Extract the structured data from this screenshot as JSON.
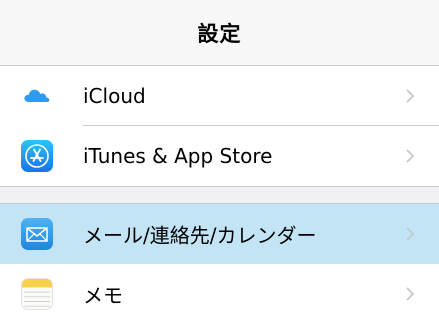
{
  "nav": {
    "title": "設定"
  },
  "settings": {
    "groups": [
      {
        "rows": [
          {
            "label": "iCloud",
            "icon": "icloud-icon",
            "selected": false
          },
          {
            "label": "iTunes & App Store",
            "icon": "app-store-icon",
            "selected": false
          }
        ]
      },
      {
        "rows": [
          {
            "label": "メール/連絡先/カレンダー",
            "icon": "mail-icon",
            "selected": true
          },
          {
            "label": "メモ",
            "icon": "notes-icon",
            "selected": false
          }
        ]
      }
    ]
  },
  "colors": {
    "selected_row": "#c2e4f4",
    "icloud_blue": "#2f9bf0",
    "app_store_blue": "#1d9bf0",
    "mail_blue": "#3aa2ec",
    "notes_yellow": "#f8d14a",
    "chevron": "#c7c7cc"
  }
}
